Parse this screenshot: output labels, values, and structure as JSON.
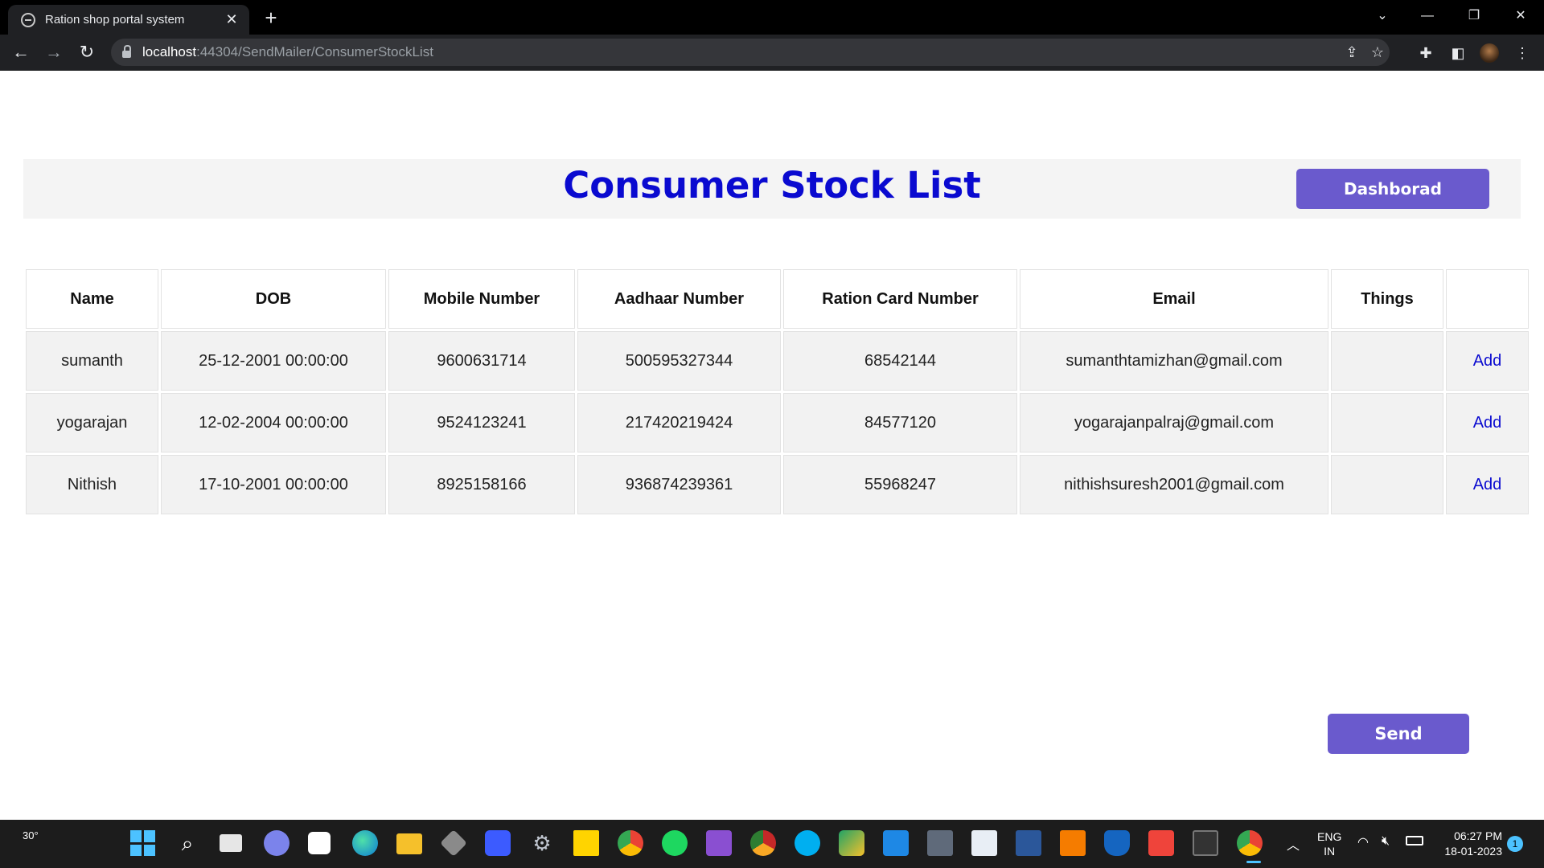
{
  "browser": {
    "tab_title": "Ration shop portal system",
    "url_host": "localhost",
    "url_rest": ":44304/SendMailer/ConsumerStockList"
  },
  "page": {
    "title": "Consumer Stock List",
    "dashboard_label": "Dashborad",
    "send_label": "Send",
    "table": {
      "headers": [
        "Name",
        "DOB",
        "Mobile Number",
        "Aadhaar Number",
        "Ration Card Number",
        "Email",
        "Things",
        ""
      ],
      "rows": [
        {
          "name": "sumanth",
          "dob": "25-12-2001 00:00:00",
          "mobile": "9600631714",
          "aadhaar": "500595327344",
          "ration_card": "68542144",
          "email": "sumanthtamizhan@gmail.com",
          "things": "",
          "action": "Add"
        },
        {
          "name": "yogarajan",
          "dob": "12-02-2004 00:00:00",
          "mobile": "9524123241",
          "aadhaar": "217420219424",
          "ration_card": "84577120",
          "email": "yogarajanpalraj@gmail.com",
          "things": "",
          "action": "Add"
        },
        {
          "name": "Nithish",
          "dob": "17-10-2001 00:00:00",
          "mobile": "8925158166",
          "aadhaar": "936874239361",
          "ration_card": "55968247",
          "email": "nithishsuresh2001@gmail.com",
          "things": "",
          "action": "Add"
        }
      ]
    }
  },
  "taskbar": {
    "weather": "30°",
    "lang_top": "ENG",
    "lang_bottom": "IN",
    "time": "06:27 PM",
    "date": "18-01-2023",
    "notification_count": "1",
    "apps": [
      "start",
      "search",
      "task-view",
      "teams",
      "store",
      "edge",
      "file-explorer",
      "unity",
      "metatrader",
      "settings",
      "sticky-notes",
      "chrome",
      "spotify",
      "visual-studio",
      "chrome-canary",
      "skype",
      "excel",
      "vscode",
      "calculator",
      "notepad",
      "word",
      "office",
      "defender",
      "anydesk",
      "terminal",
      "chrome-active"
    ]
  },
  "colors": {
    "title": "#0a0ad0",
    "button": "#6a5acd",
    "header_bar": "#f4f4f4",
    "row_bg": "#f2f2f2"
  }
}
